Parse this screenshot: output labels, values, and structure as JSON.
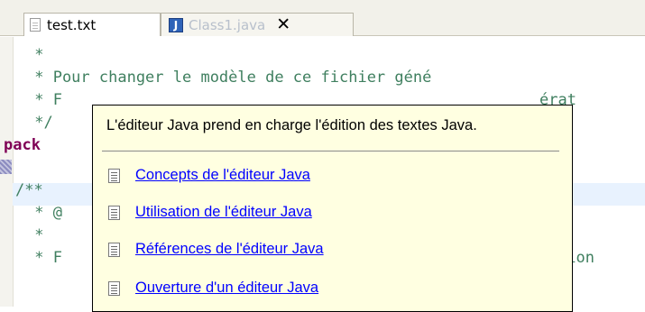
{
  "tabs": [
    {
      "label": "test.txt",
      "active": false
    },
    {
      "label": "Class1.java",
      "active": true
    }
  ],
  "tab_icon_java": "J",
  "tab_close_glyph": "✕",
  "code_lines": [
    {
      "pre": " *",
      "kw": "",
      "post": ""
    },
    {
      "pre": " * Pour changer le modèle de ce fichier géné",
      "kw": "",
      "post": ""
    },
    {
      "pre": " * F",
      "kw": "",
      "post": ""
    },
    {
      "pre": " */",
      "kw": "",
      "post": ""
    },
    {
      "pre": "",
      "kw": "pack",
      "post": ""
    },
    {
      "pre": "",
      "kw": "",
      "post": ""
    },
    {
      "pre": "/**",
      "kw": "",
      "post": ""
    },
    {
      "pre": " * @",
      "kw": "",
      "post": ""
    },
    {
      "pre": " *",
      "kw": "",
      "post": ""
    },
    {
      "pre": " * F",
      "kw": "",
      "post": ""
    }
  ],
  "code_visible_right": "érat",
  "code_visible_right2": "tion",
  "popup": {
    "title": "L'éditeur Java prend en charge l'édition des textes Java.",
    "links": [
      "Concepts de l'éditeur Java",
      "Utilisation de l'éditeur Java",
      "Références de l'éditeur Java",
      "Ouverture d'un éditeur Java"
    ]
  },
  "colors": {
    "comment": "#3f7f5f",
    "keyword": "#7f0055",
    "popup_bg": "#ffffe1",
    "link": "#0000ff"
  }
}
